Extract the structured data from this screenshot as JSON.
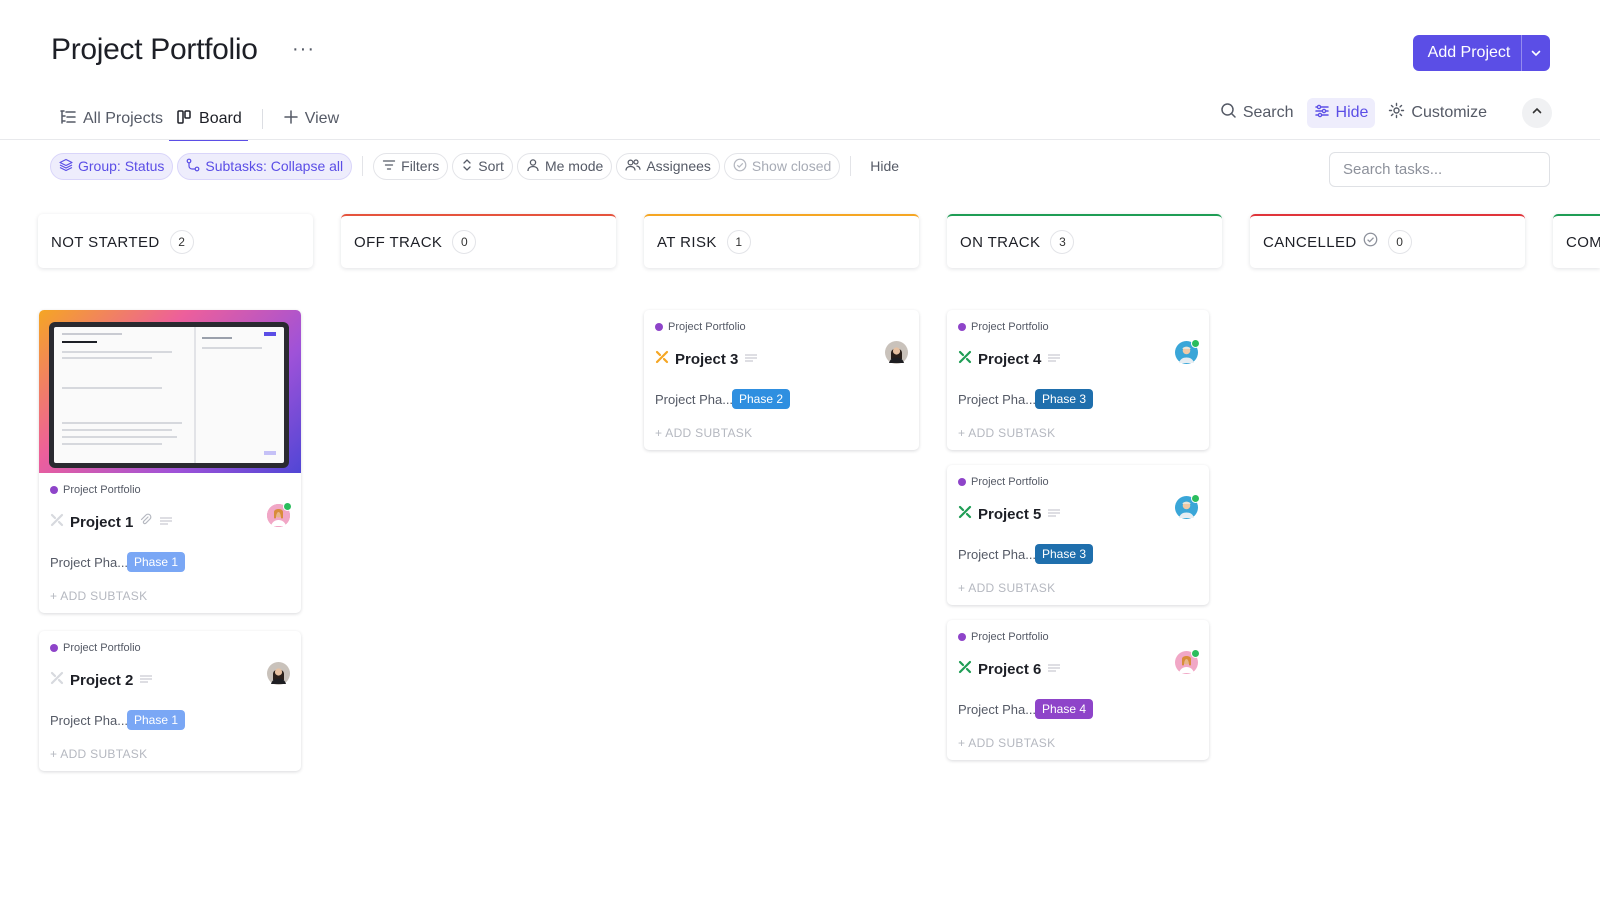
{
  "header": {
    "title": "Project Portfolio",
    "more": "···",
    "add_button": "Add Project"
  },
  "tabs": [
    {
      "label": "All Projects",
      "icon": "list-tree-icon"
    },
    {
      "label": "Board",
      "icon": "board-icon",
      "active": true
    },
    {
      "label": "View",
      "icon": "plus-icon"
    }
  ],
  "tools": {
    "search": "Search",
    "hide": "Hide",
    "customize": "Customize"
  },
  "filters": {
    "group": "Group: Status",
    "subtasks": "Subtasks: Collapse all",
    "filters": "Filters",
    "sort": "Sort",
    "me_mode": "Me mode",
    "assignees": "Assignees",
    "show_closed": "Show closed",
    "hide": "Hide",
    "search_placeholder": "Search tasks..."
  },
  "colors": {
    "accent": "#5b4ee6",
    "not_started": "#e3e4e8",
    "off_track": "#e5533d",
    "at_risk": "#f5a623",
    "on_track": "#1f9d55",
    "cancelled": "#e0343a",
    "phase1": "#7aa7f5",
    "phase2": "#2f8fe0",
    "phase3": "#1f6fad",
    "phase4": "#8e44c9"
  },
  "columns": [
    {
      "name": "NOT STARTED",
      "count": "2"
    },
    {
      "name": "OFF TRACK",
      "count": "0"
    },
    {
      "name": "AT RISK",
      "count": "1"
    },
    {
      "name": "ON TRACK",
      "count": "3"
    },
    {
      "name": "CANCELLED",
      "count": "0"
    },
    {
      "name": "COM",
      "count": ""
    }
  ],
  "cards": {
    "list_name": "Project Portfolio",
    "field_label": "Project Pha...",
    "add_subtask": "+ ADD SUBTASK",
    "items": [
      {
        "title": "Project 1",
        "phase": "Phase 1"
      },
      {
        "title": "Project 2",
        "phase": "Phase 1"
      },
      {
        "title": "Project 3",
        "phase": "Phase 2"
      },
      {
        "title": "Project 4",
        "phase": "Phase 3"
      },
      {
        "title": "Project 5",
        "phase": "Phase 3"
      },
      {
        "title": "Project 6",
        "phase": "Phase 4"
      }
    ]
  }
}
